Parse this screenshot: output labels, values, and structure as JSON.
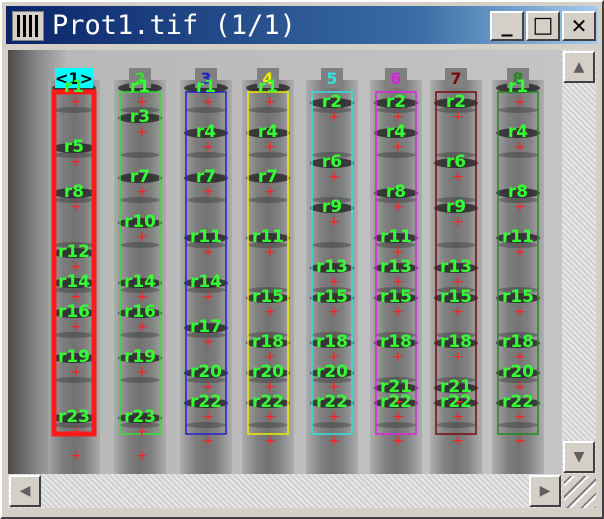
{
  "window": {
    "title": "Prot1.tif (1/1)",
    "buttons": {
      "minimize": "_",
      "maximize": "□",
      "close": "✕"
    }
  },
  "scrollbars": {
    "up_arrow": "▲",
    "down_arrow": "▼",
    "left_arrow": "◀",
    "right_arrow": "▶"
  },
  "lanes": [
    {
      "label": "<1>",
      "color": "#ff1a1a",
      "selected": true,
      "bands": [
        "r1",
        "r5",
        "r8",
        "r12",
        "r14",
        "r16",
        "r19",
        "r23"
      ]
    },
    {
      "label": "2",
      "color": "#33dd33",
      "selected": false,
      "bands": [
        "r1",
        "r3",
        "r7",
        "r10",
        "r14",
        "r16",
        "r19",
        "r23"
      ]
    },
    {
      "label": "3",
      "color": "#2222cc",
      "selected": false,
      "bands": [
        "r1",
        "r4",
        "r7",
        "r11",
        "r14",
        "r17",
        "r20",
        "r22"
      ]
    },
    {
      "label": "4",
      "color": "#eeee00",
      "selected": false,
      "bands": [
        "r1",
        "r4",
        "r7",
        "r11",
        "r15",
        "r18",
        "r20",
        "r22"
      ]
    },
    {
      "label": "5",
      "color": "#33e0e0",
      "selected": false,
      "bands": [
        "r2",
        "r6",
        "r9",
        "r13",
        "r15",
        "r18",
        "r20",
        "r22"
      ]
    },
    {
      "label": "6",
      "color": "#dd22dd",
      "selected": false,
      "bands": [
        "r2",
        "r4",
        "r8",
        "r11",
        "r13",
        "r15",
        "r18",
        "r21",
        "r22"
      ]
    },
    {
      "label": "7",
      "color": "#7a0a0a",
      "selected": false,
      "bands": [
        "r2",
        "r6",
        "r9",
        "r13",
        "r15",
        "r18",
        "r21",
        "r22"
      ]
    },
    {
      "label": "8",
      "color": "#1f8a1f",
      "selected": false,
      "bands": [
        "r1",
        "r4",
        "r8",
        "r11",
        "r15",
        "r18",
        "r20",
        "r22"
      ]
    }
  ],
  "colors": {
    "band_label": "#33ff33",
    "band_marker": "#ff2020",
    "label_bg": "#808080",
    "selected_label_bg": "#00ffff"
  }
}
